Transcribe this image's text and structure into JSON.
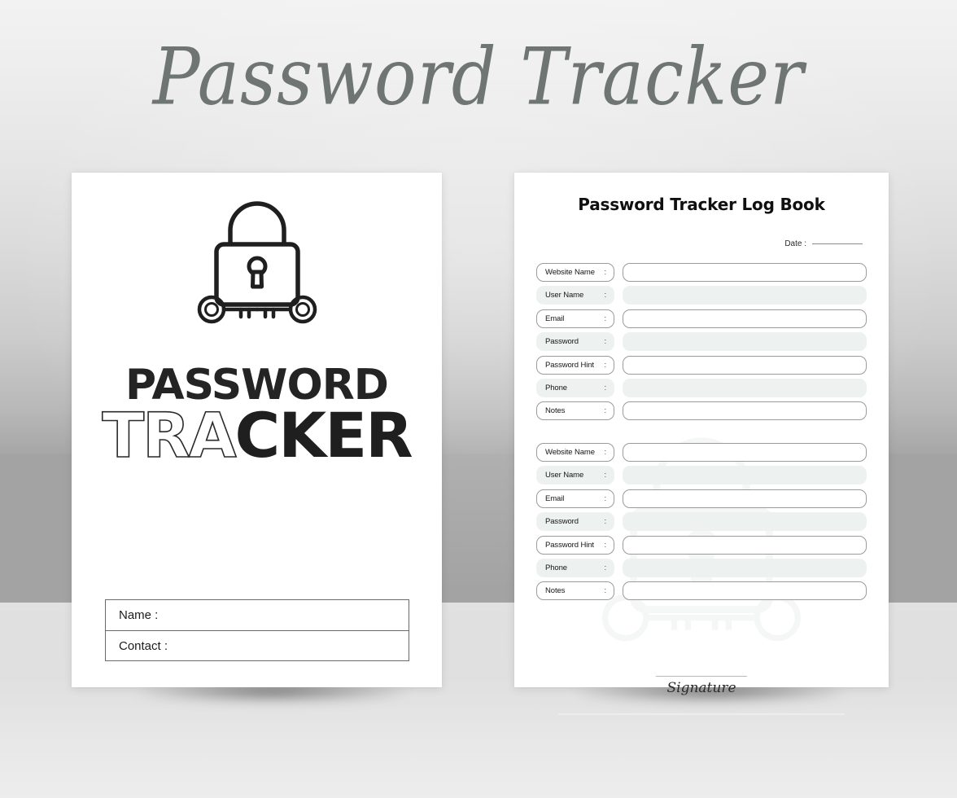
{
  "poster": {
    "title": "Password Tracker"
  },
  "cover": {
    "logo_icon": "padlock-with-crossed-keys-icon",
    "wordmark": {
      "line1": "PASSWORD",
      "line2_outline": "TRA",
      "line2_solid": "CKER"
    },
    "fields": [
      {
        "label": "Name :"
      },
      {
        "label": "Contact :"
      }
    ]
  },
  "interior": {
    "title": "Password Tracker Log Book",
    "date": {
      "label": "Date :"
    },
    "watermark_icon": "padlock-watermark-icon",
    "row_labels": [
      "Website Name",
      "User Name",
      "Email",
      "Password",
      "Password Hint",
      "Phone",
      "Notes"
    ],
    "colon": ":",
    "blocks": [
      {
        "rows": [
          {
            "label": "Website Name",
            "colon": ":",
            "style": "outline",
            "value": ""
          },
          {
            "label": "User Name",
            "colon": ":",
            "style": "fill",
            "value": ""
          },
          {
            "label": "Email",
            "colon": ":",
            "style": "outline",
            "value": ""
          },
          {
            "label": "Password",
            "colon": ":",
            "style": "fill",
            "value": ""
          },
          {
            "label": "Password Hint",
            "colon": ":",
            "style": "outline",
            "value": ""
          },
          {
            "label": "Phone",
            "colon": ":",
            "style": "fill",
            "value": ""
          },
          {
            "label": "Notes",
            "colon": ":",
            "style": "outline",
            "value": ""
          }
        ]
      },
      {
        "rows": [
          {
            "label": "Website Name",
            "colon": ":",
            "style": "outline",
            "value": ""
          },
          {
            "label": "User Name",
            "colon": ":",
            "style": "fill",
            "value": ""
          },
          {
            "label": "Email",
            "colon": ":",
            "style": "outline",
            "value": ""
          },
          {
            "label": "Password",
            "colon": ":",
            "style": "fill",
            "value": ""
          },
          {
            "label": "Password Hint",
            "colon": ":",
            "style": "outline",
            "value": ""
          },
          {
            "label": "Phone",
            "colon": ":",
            "style": "fill",
            "value": ""
          },
          {
            "label": "Notes",
            "colon": ":",
            "style": "outline",
            "value": ""
          }
        ]
      }
    ],
    "signature": {
      "word": "Signature",
      "left_icon": "key-icon",
      "right_icon": "key-icon"
    }
  },
  "colors": {
    "title_gray": "#6f7573",
    "ink": "#1f1f1f",
    "row_fill_mint": "#edf2f0",
    "row_border": "#9b9b9b",
    "page_white": "#ffffff"
  }
}
